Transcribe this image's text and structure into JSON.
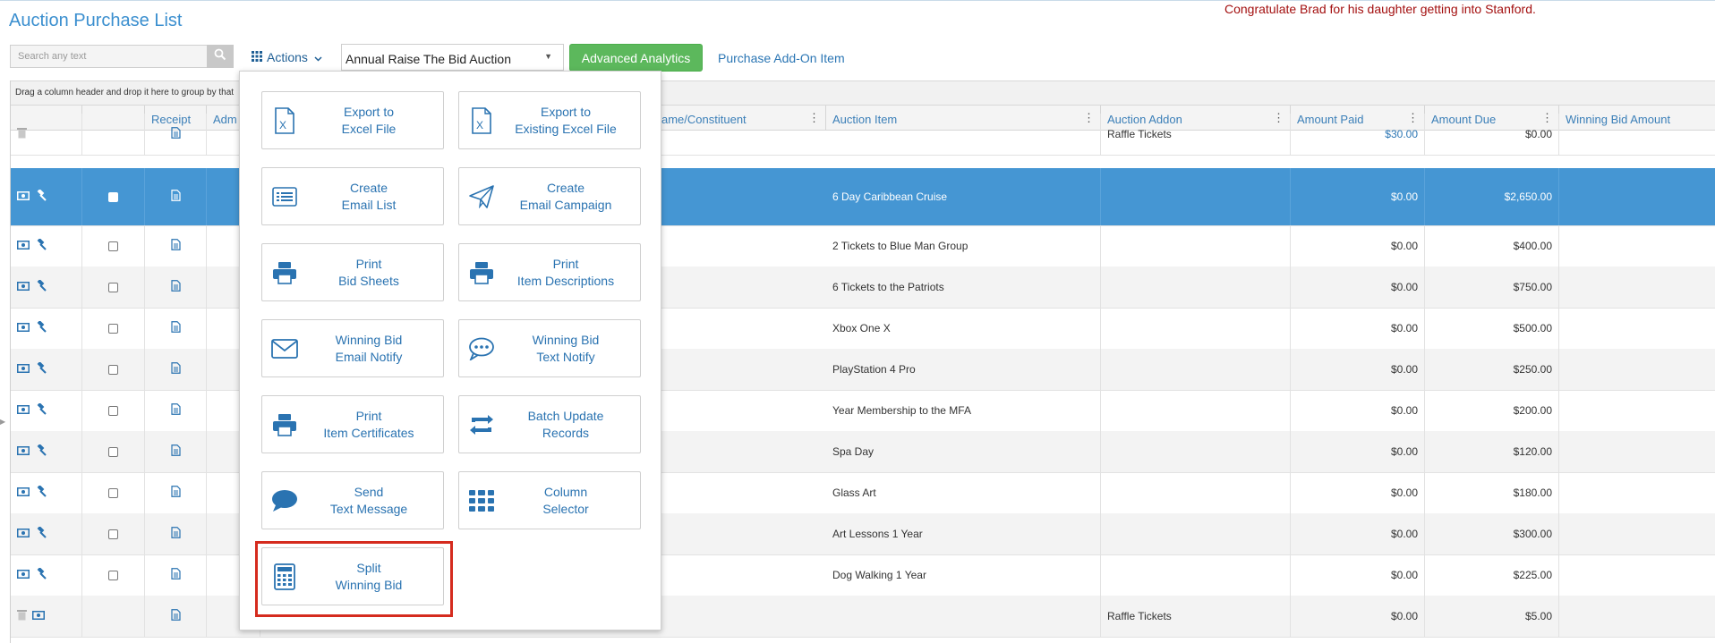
{
  "page": {
    "title": "Auction Purchase List",
    "notice": "Congratulate Brad for his daughter getting into Stanford."
  },
  "toolbar": {
    "search_placeholder": "Search any text",
    "actions_label": "Actions",
    "auction_select": "Annual Raise The Bid Auction",
    "analytics_label": "Advanced Analytics",
    "addon_link": "Purchase Add-On Item"
  },
  "grid": {
    "group_hint": "Drag a column header and drop it here to group by that",
    "headers": {
      "receipt": "Receipt",
      "admin": "Adm",
      "name": "ame/Constituent",
      "item": "Auction Item",
      "addon": "Auction Addon",
      "paid": "Amount Paid",
      "due": "Amount Due",
      "winning": "Winning Bid Amount"
    },
    "rows": [
      {
        "item": "",
        "addon": "Raffle Tickets",
        "paid": "$30.00",
        "due": "$0.00"
      },
      {
        "item": "6 Day Caribbean Cruise",
        "addon": "",
        "paid": "$0.00",
        "due": "$2,650.00"
      },
      {
        "item": "2 Tickets to Blue Man Group",
        "addon": "",
        "paid": "$0.00",
        "due": "$400.00"
      },
      {
        "item": "6 Tickets to the Patriots",
        "addon": "",
        "paid": "$0.00",
        "due": "$750.00"
      },
      {
        "item": "Xbox One X",
        "addon": "",
        "paid": "$0.00",
        "due": "$500.00"
      },
      {
        "item": "PlayStation 4 Pro",
        "addon": "",
        "paid": "$0.00",
        "due": "$250.00"
      },
      {
        "item": "Year Membership to the MFA",
        "addon": "",
        "paid": "$0.00",
        "due": "$200.00"
      },
      {
        "item": "Spa Day",
        "addon": "",
        "paid": "$0.00",
        "due": "$120.00"
      },
      {
        "item": "Glass Art",
        "addon": "",
        "paid": "$0.00",
        "due": "$180.00"
      },
      {
        "item": "Art Lessons 1 Year",
        "addon": "",
        "paid": "$0.00",
        "due": "$300.00"
      },
      {
        "item": "Dog Walking 1 Year",
        "addon": "",
        "paid": "$0.00",
        "due": "$225.00"
      },
      {
        "item": "",
        "addon": "Raffle Tickets",
        "paid": "$0.00",
        "due": "$5.00"
      }
    ]
  },
  "actions_menu": {
    "export_excel": {
      "line1": "Export to",
      "line2": "Excel File"
    },
    "export_existing": {
      "line1": "Export to",
      "line2": "Existing Excel File"
    },
    "create_email_list": {
      "line1": "Create",
      "line2": "Email List"
    },
    "create_email_campaign": {
      "line1": "Create",
      "line2": "Email Campaign"
    },
    "print_bid_sheets": {
      "line1": "Print",
      "line2": "Bid Sheets"
    },
    "print_item_descriptions": {
      "line1": "Print",
      "line2": "Item Descriptions"
    },
    "winning_email": {
      "line1": "Winning Bid",
      "line2": "Email Notify"
    },
    "winning_text": {
      "line1": "Winning Bid",
      "line2": "Text Notify"
    },
    "print_certificates": {
      "line1": "Print",
      "line2": "Item Certificates"
    },
    "batch_update": {
      "line1": "Batch Update",
      "line2": "Records"
    },
    "send_text": {
      "line1": "Send",
      "line2": "Text Message"
    },
    "column_selector": {
      "line1": "Column",
      "line2": "Selector"
    },
    "split_winning_bid": {
      "line1": "Split",
      "line2": "Winning Bid"
    }
  },
  "colors": {
    "accent": "#3b8fcf",
    "selected_row": "#4596d3",
    "analytics": "#5cb85c",
    "notice": "#a30f0f",
    "highlight": "#d52b1e"
  }
}
